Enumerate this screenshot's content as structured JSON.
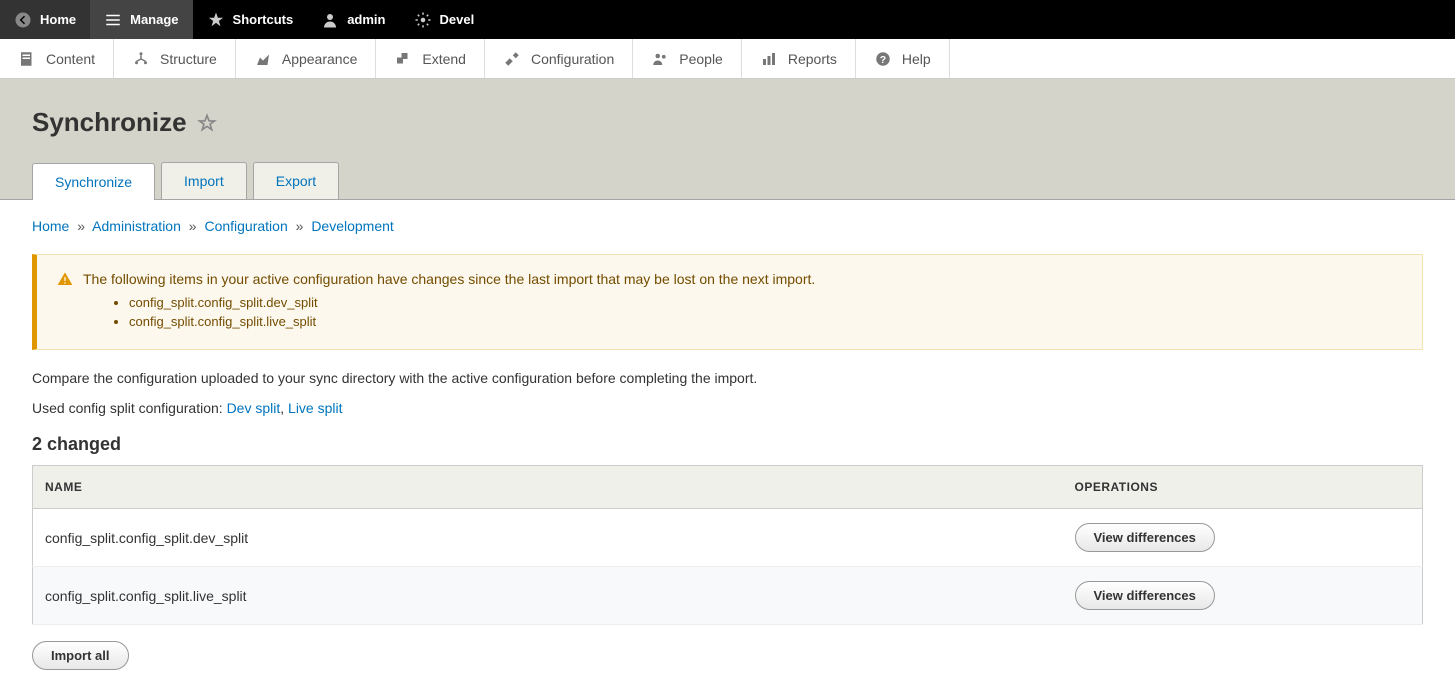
{
  "toolbar_top": {
    "home": "Home",
    "manage": "Manage",
    "shortcuts": "Shortcuts",
    "user": "admin",
    "devel": "Devel"
  },
  "admin_menu": {
    "content": "Content",
    "structure": "Structure",
    "appearance": "Appearance",
    "extend": "Extend",
    "configuration": "Configuration",
    "people": "People",
    "reports": "Reports",
    "help": "Help"
  },
  "page": {
    "title": "Synchronize"
  },
  "tabs": {
    "synchronize": "Synchronize",
    "import": "Import",
    "export": "Export"
  },
  "breadcrumb": {
    "home": "Home",
    "administration": "Administration",
    "configuration": "Configuration",
    "development": "Development",
    "sep": "»"
  },
  "warning": {
    "message": "The following items in your active configuration have changes since the last import that may be lost on the next import.",
    "items": [
      "config_split.config_split.dev_split",
      "config_split.config_split.live_split"
    ]
  },
  "description": {
    "compare": "Compare the configuration uploaded to your sync directory with the active configuration before completing the import.",
    "used_prefix": "Used config split configuration: ",
    "dev_split_link": "Dev split",
    "live_split_link": "Live split",
    "sep": ", "
  },
  "changed": {
    "heading": "2 changed",
    "columns": {
      "name": "NAME",
      "operations": "OPERATIONS"
    },
    "rows": [
      {
        "name": "config_split.config_split.dev_split",
        "op": "View differences"
      },
      {
        "name": "config_split.config_split.live_split",
        "op": "View differences"
      }
    ]
  },
  "actions": {
    "import_all": "Import all"
  }
}
